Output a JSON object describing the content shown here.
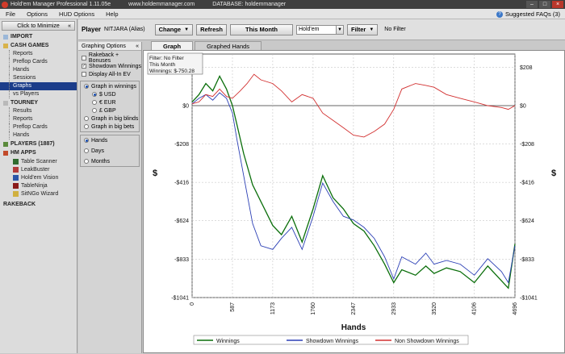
{
  "titlebar": {
    "app_title": "Hold'em Manager Professional 1.11.05e",
    "site": "www.holdemmanager.com",
    "database": "DATABASE: holdemmanager"
  },
  "menu": {
    "items": [
      "File",
      "Options",
      "HUD Options",
      "Help"
    ],
    "faq": "Suggested FAQs (3)"
  },
  "sidebar": {
    "minimize_label": "Click to Minimize",
    "import": "IMPORT",
    "cash_games": "CASH GAMES",
    "cash_items": [
      "Reports",
      "Preflop Cards",
      "Hands",
      "Sessions",
      "Graphs",
      "vs Players"
    ],
    "tourney": "TOURNEY",
    "tourney_items": [
      "Results",
      "Reports",
      "Preflop Cards",
      "Hands"
    ],
    "players": "PLAYERS (1887)",
    "hm_apps": "HM APPS",
    "apps": [
      "Table Scanner",
      "LeakBuster",
      "Hold'em Vision",
      "TableNinja",
      "SitNGo Wizard"
    ],
    "rakeback": "RAKEBACK"
  },
  "toolbar": {
    "player_label": "Player",
    "player_value": "NITJARA (Alias)",
    "change": "Change",
    "refresh": "Refresh",
    "period": "This Month",
    "game": "Hold'em",
    "filter": "Filter",
    "filter_status": "No Filter"
  },
  "graph_options": {
    "title": "Graphing Options",
    "rakeback_bonuses": "Rakeback + Bonuses",
    "showdown_winnings": "Showdown Winnings",
    "display_allin_ev": "Display All-In EV",
    "graph_in_winnings": "Graph in winnings",
    "usd": "$ USD",
    "eur": "€ EUR",
    "gbp": "£ GBP",
    "graph_in_bb": "Graph in big blinds",
    "graph_in_big_bets": "Graph in big bets",
    "hands": "Hands",
    "days": "Days",
    "months": "Months"
  },
  "tabs": [
    "Graph",
    "Graphed Hands"
  ],
  "chart_data": {
    "type": "line",
    "info": [
      "Filter: No Filter",
      "This Month",
      "Winnings: $-750.28"
    ],
    "xlabel": "Hands",
    "ylabel": "$",
    "xlim": [
      0,
      4696
    ],
    "ylim": [
      -1041,
      280
    ],
    "x_ticks": [
      0,
      587,
      1173,
      1760,
      2347,
      2933,
      3520,
      4106,
      4696
    ],
    "y_ticks": [
      208,
      0,
      -208,
      -416,
      -624,
      -833,
      -1041
    ],
    "y_tick_labels": [
      "$208",
      "$0",
      "-$208",
      "-$416",
      "-$624",
      "-$833",
      "-$1041"
    ],
    "series": [
      {
        "name": "Winnings",
        "color": "#0a6e0a",
        "x": [
          0,
          100,
          200,
          300,
          400,
          500,
          587,
          650,
          750,
          880,
          1000,
          1173,
          1300,
          1450,
          1600,
          1760,
          1900,
          2050,
          2200,
          2347,
          2500,
          2650,
          2800,
          2933,
          3050,
          3250,
          3400,
          3520,
          3700,
          3900,
          4106,
          4300,
          4500,
          4600,
          4696
        ],
        "y": [
          20,
          60,
          120,
          80,
          160,
          90,
          0,
          -100,
          -260,
          -430,
          -520,
          -650,
          -700,
          -600,
          -740,
          -560,
          -380,
          -500,
          -560,
          -640,
          -680,
          -760,
          -860,
          -960,
          -890,
          -920,
          -870,
          -910,
          -880,
          -900,
          -960,
          -870,
          -950,
          -990,
          -750
        ]
      },
      {
        "name": "Showdown Winnings",
        "color": "#2b3fb5",
        "x": [
          0,
          100,
          200,
          300,
          400,
          500,
          587,
          650,
          750,
          880,
          1000,
          1173,
          1300,
          1450,
          1600,
          1760,
          1900,
          2050,
          2200,
          2347,
          2500,
          2650,
          2800,
          2933,
          3050,
          3250,
          3400,
          3520,
          3700,
          3900,
          4106,
          4300,
          4500,
          4600,
          4696
        ],
        "y": [
          10,
          40,
          60,
          30,
          70,
          40,
          -40,
          -180,
          -380,
          -640,
          -760,
          -780,
          -720,
          -660,
          -780,
          -600,
          -420,
          -520,
          -600,
          -620,
          -660,
          -720,
          -820,
          -940,
          -820,
          -860,
          -800,
          -860,
          -840,
          -860,
          -920,
          -830,
          -900,
          -960,
          -760
        ]
      },
      {
        "name": "Non Showdown Winnings",
        "color": "#d23030",
        "x": [
          0,
          100,
          200,
          300,
          400,
          500,
          587,
          700,
          800,
          900,
          1000,
          1173,
          1300,
          1450,
          1600,
          1760,
          1900,
          2050,
          2200,
          2347,
          2500,
          2650,
          2800,
          2933,
          3050,
          3250,
          3400,
          3520,
          3700,
          3900,
          4106,
          4300,
          4500,
          4600,
          4696
        ],
        "y": [
          10,
          20,
          60,
          50,
          90,
          50,
          40,
          80,
          120,
          170,
          140,
          120,
          80,
          20,
          60,
          40,
          -40,
          -80,
          -120,
          -160,
          -170,
          -140,
          -100,
          -20,
          90,
          120,
          110,
          100,
          60,
          40,
          20,
          0,
          -10,
          -20,
          0
        ]
      }
    ]
  }
}
